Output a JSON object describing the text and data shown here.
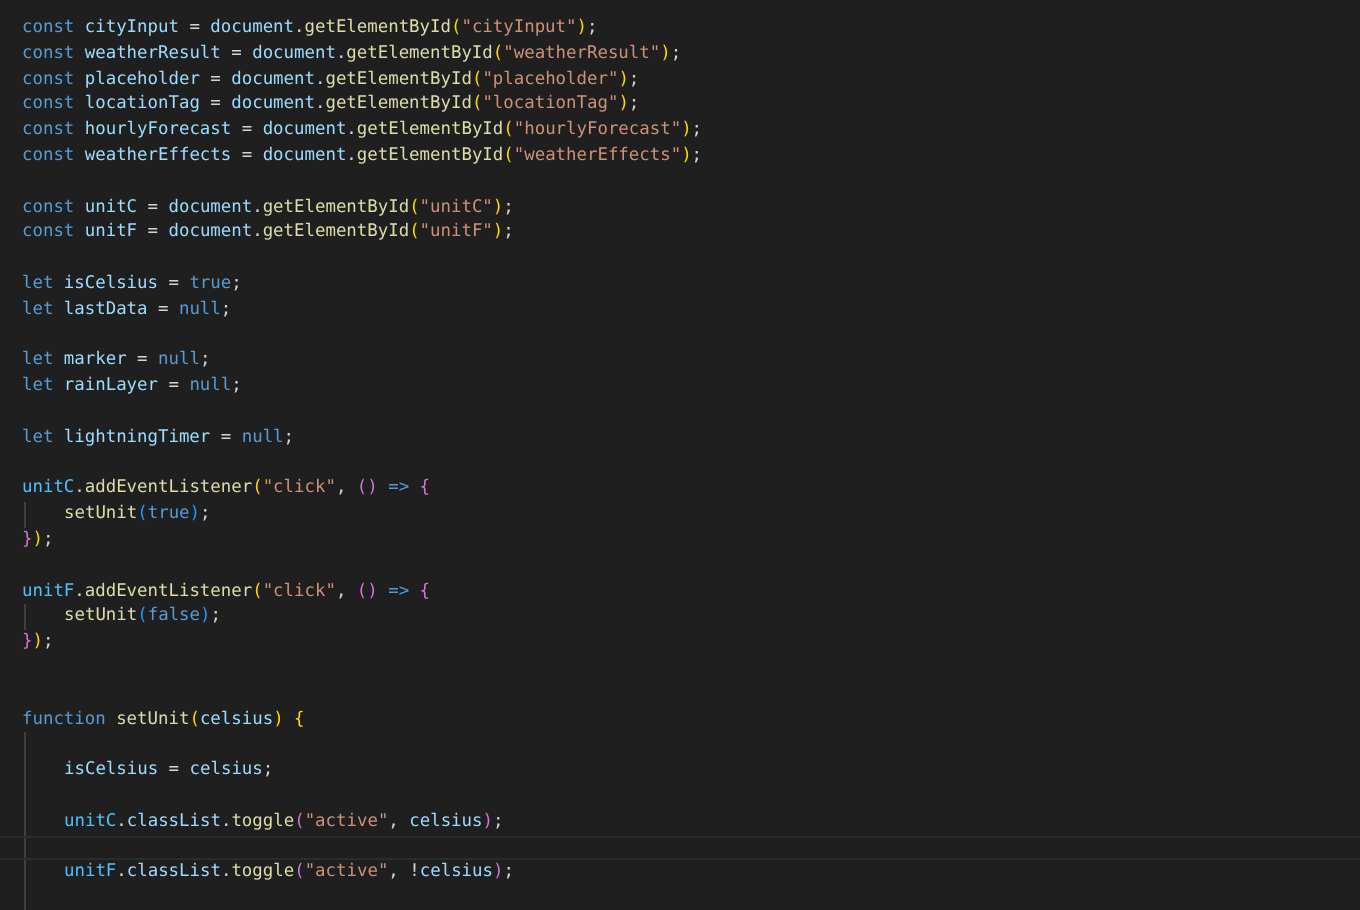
{
  "editor": {
    "lines": [
      {
        "kind": "code",
        "indented": false,
        "tokens": [
          {
            "kind": "keyword",
            "text": "const "
          },
          {
            "kind": "variable",
            "text": "cityInput"
          },
          {
            "kind": "plain",
            "text": " = "
          },
          {
            "kind": "variable",
            "text": "document"
          },
          {
            "kind": "plain",
            "text": "."
          },
          {
            "kind": "function",
            "text": "getElementById"
          },
          {
            "kind": "bracket1",
            "text": "("
          },
          {
            "kind": "string",
            "text": "\"cityInput\""
          },
          {
            "kind": "bracket1",
            "text": ")"
          },
          {
            "kind": "plain",
            "text": ";"
          }
        ]
      },
      {
        "kind": "code",
        "indented": false,
        "tokens": [
          {
            "kind": "keyword",
            "text": "const "
          },
          {
            "kind": "variable",
            "text": "weatherResult"
          },
          {
            "kind": "plain",
            "text": " = "
          },
          {
            "kind": "variable",
            "text": "document"
          },
          {
            "kind": "plain",
            "text": "."
          },
          {
            "kind": "function",
            "text": "getElementById"
          },
          {
            "kind": "bracket1",
            "text": "("
          },
          {
            "kind": "string",
            "text": "\"weatherResult\""
          },
          {
            "kind": "bracket1",
            "text": ")"
          },
          {
            "kind": "plain",
            "text": ";"
          }
        ]
      },
      {
        "kind": "code",
        "indented": false,
        "tokens": [
          {
            "kind": "keyword",
            "text": "const "
          },
          {
            "kind": "variable",
            "text": "placeholder"
          },
          {
            "kind": "plain",
            "text": " = "
          },
          {
            "kind": "variable",
            "text": "document"
          },
          {
            "kind": "plain",
            "text": "."
          },
          {
            "kind": "function",
            "text": "getElementById"
          },
          {
            "kind": "bracket1",
            "text": "("
          },
          {
            "kind": "string",
            "text": "\"placeholder\""
          },
          {
            "kind": "bracket1",
            "text": ")"
          },
          {
            "kind": "plain",
            "text": ";"
          }
        ]
      },
      {
        "kind": "code",
        "indented": false,
        "tokens": [
          {
            "kind": "keyword",
            "text": "const "
          },
          {
            "kind": "variable",
            "text": "locationTag"
          },
          {
            "kind": "plain",
            "text": " = "
          },
          {
            "kind": "variable",
            "text": "document"
          },
          {
            "kind": "plain",
            "text": "."
          },
          {
            "kind": "function",
            "text": "getElementById"
          },
          {
            "kind": "bracket1",
            "text": "("
          },
          {
            "kind": "string",
            "text": "\"locationTag\""
          },
          {
            "kind": "bracket1",
            "text": ")"
          },
          {
            "kind": "plain",
            "text": ";"
          }
        ]
      },
      {
        "kind": "code",
        "indented": false,
        "tokens": [
          {
            "kind": "keyword",
            "text": "const "
          },
          {
            "kind": "variable",
            "text": "hourlyForecast"
          },
          {
            "kind": "plain",
            "text": " = "
          },
          {
            "kind": "variable",
            "text": "document"
          },
          {
            "kind": "plain",
            "text": "."
          },
          {
            "kind": "function",
            "text": "getElementById"
          },
          {
            "kind": "bracket1",
            "text": "("
          },
          {
            "kind": "string",
            "text": "\"hourlyForecast\""
          },
          {
            "kind": "bracket1",
            "text": ")"
          },
          {
            "kind": "plain",
            "text": ";"
          }
        ]
      },
      {
        "kind": "code",
        "indented": false,
        "tokens": [
          {
            "kind": "keyword",
            "text": "const "
          },
          {
            "kind": "variable",
            "text": "weatherEffects"
          },
          {
            "kind": "plain",
            "text": " = "
          },
          {
            "kind": "variable",
            "text": "document"
          },
          {
            "kind": "plain",
            "text": "."
          },
          {
            "kind": "function",
            "text": "getElementById"
          },
          {
            "kind": "bracket1",
            "text": "("
          },
          {
            "kind": "string",
            "text": "\"weatherEffects\""
          },
          {
            "kind": "bracket1",
            "text": ")"
          },
          {
            "kind": "plain",
            "text": ";"
          }
        ]
      },
      {
        "kind": "blank",
        "indented": false
      },
      {
        "kind": "code",
        "indented": false,
        "tokens": [
          {
            "kind": "keyword",
            "text": "const "
          },
          {
            "kind": "variable",
            "text": "unitC"
          },
          {
            "kind": "plain",
            "text": " = "
          },
          {
            "kind": "variable",
            "text": "document"
          },
          {
            "kind": "plain",
            "text": "."
          },
          {
            "kind": "function",
            "text": "getElementById"
          },
          {
            "kind": "bracket1",
            "text": "("
          },
          {
            "kind": "string",
            "text": "\"unitC\""
          },
          {
            "kind": "bracket1",
            "text": ")"
          },
          {
            "kind": "plain",
            "text": ";"
          }
        ]
      },
      {
        "kind": "code",
        "indented": false,
        "tokens": [
          {
            "kind": "keyword",
            "text": "const "
          },
          {
            "kind": "variable",
            "text": "unitF"
          },
          {
            "kind": "plain",
            "text": " = "
          },
          {
            "kind": "variable",
            "text": "document"
          },
          {
            "kind": "plain",
            "text": "."
          },
          {
            "kind": "function",
            "text": "getElementById"
          },
          {
            "kind": "bracket1",
            "text": "("
          },
          {
            "kind": "string",
            "text": "\"unitF\""
          },
          {
            "kind": "bracket1",
            "text": ")"
          },
          {
            "kind": "plain",
            "text": ";"
          }
        ]
      },
      {
        "kind": "blank",
        "indented": false
      },
      {
        "kind": "code",
        "indented": false,
        "tokens": [
          {
            "kind": "keyword",
            "text": "let "
          },
          {
            "kind": "variable",
            "text": "isCelsius"
          },
          {
            "kind": "plain",
            "text": " = "
          },
          {
            "kind": "literal",
            "text": "true"
          },
          {
            "kind": "plain",
            "text": ";"
          }
        ]
      },
      {
        "kind": "code",
        "indented": false,
        "tokens": [
          {
            "kind": "keyword",
            "text": "let "
          },
          {
            "kind": "variable",
            "text": "lastData"
          },
          {
            "kind": "plain",
            "text": " = "
          },
          {
            "kind": "literal",
            "text": "null"
          },
          {
            "kind": "plain",
            "text": ";"
          }
        ]
      },
      {
        "kind": "blank",
        "indented": false
      },
      {
        "kind": "code",
        "indented": false,
        "tokens": [
          {
            "kind": "keyword",
            "text": "let "
          },
          {
            "kind": "variable",
            "text": "marker"
          },
          {
            "kind": "plain",
            "text": " = "
          },
          {
            "kind": "literal",
            "text": "null"
          },
          {
            "kind": "plain",
            "text": ";"
          }
        ]
      },
      {
        "kind": "code",
        "indented": false,
        "tokens": [
          {
            "kind": "keyword",
            "text": "let "
          },
          {
            "kind": "variable",
            "text": "rainLayer"
          },
          {
            "kind": "plain",
            "text": " = "
          },
          {
            "kind": "literal",
            "text": "null"
          },
          {
            "kind": "plain",
            "text": ";"
          }
        ]
      },
      {
        "kind": "blank",
        "indented": false
      },
      {
        "kind": "code",
        "indented": false,
        "tokens": [
          {
            "kind": "keyword",
            "text": "let "
          },
          {
            "kind": "variable",
            "text": "lightningTimer"
          },
          {
            "kind": "plain",
            "text": " = "
          },
          {
            "kind": "literal",
            "text": "null"
          },
          {
            "kind": "plain",
            "text": ";"
          }
        ]
      },
      {
        "kind": "blank",
        "indented": false
      },
      {
        "kind": "code",
        "indented": false,
        "tokens": [
          {
            "kind": "constant",
            "text": "unitC"
          },
          {
            "kind": "plain",
            "text": "."
          },
          {
            "kind": "function",
            "text": "addEventListener"
          },
          {
            "kind": "bracket1",
            "text": "("
          },
          {
            "kind": "string",
            "text": "\"click\""
          },
          {
            "kind": "plain",
            "text": ", "
          },
          {
            "kind": "bracket2",
            "text": "()"
          },
          {
            "kind": "keyword",
            "text": " => "
          },
          {
            "kind": "bracket2",
            "text": "{"
          }
        ]
      },
      {
        "kind": "code",
        "indented": true,
        "tokens": [
          {
            "kind": "function",
            "text": "setUnit"
          },
          {
            "kind": "bracket3",
            "text": "("
          },
          {
            "kind": "literal",
            "text": "true"
          },
          {
            "kind": "bracket3",
            "text": ")"
          },
          {
            "kind": "plain",
            "text": ";"
          }
        ]
      },
      {
        "kind": "code",
        "indented": false,
        "tokens": [
          {
            "kind": "bracket2",
            "text": "}"
          },
          {
            "kind": "bracket1",
            "text": ")"
          },
          {
            "kind": "plain",
            "text": ";"
          }
        ]
      },
      {
        "kind": "blank",
        "indented": false
      },
      {
        "kind": "code",
        "indented": false,
        "tokens": [
          {
            "kind": "constant",
            "text": "unitF"
          },
          {
            "kind": "plain",
            "text": "."
          },
          {
            "kind": "function",
            "text": "addEventListener"
          },
          {
            "kind": "bracket1",
            "text": "("
          },
          {
            "kind": "string",
            "text": "\"click\""
          },
          {
            "kind": "plain",
            "text": ", "
          },
          {
            "kind": "bracket2",
            "text": "()"
          },
          {
            "kind": "keyword",
            "text": " => "
          },
          {
            "kind": "bracket2",
            "text": "{"
          }
        ]
      },
      {
        "kind": "code",
        "indented": true,
        "tokens": [
          {
            "kind": "function",
            "text": "setUnit"
          },
          {
            "kind": "bracket3",
            "text": "("
          },
          {
            "kind": "literal",
            "text": "false"
          },
          {
            "kind": "bracket3",
            "text": ")"
          },
          {
            "kind": "plain",
            "text": ";"
          }
        ]
      },
      {
        "kind": "code",
        "indented": false,
        "tokens": [
          {
            "kind": "bracket2",
            "text": "}"
          },
          {
            "kind": "bracket1",
            "text": ")"
          },
          {
            "kind": "plain",
            "text": ";"
          }
        ]
      },
      {
        "kind": "blank",
        "indented": false
      },
      {
        "kind": "blank",
        "indented": false
      },
      {
        "kind": "code",
        "indented": false,
        "tokens": [
          {
            "kind": "keyword",
            "text": "function "
          },
          {
            "kind": "function",
            "text": "setUnit"
          },
          {
            "kind": "bracket1",
            "text": "("
          },
          {
            "kind": "variable",
            "text": "celsius"
          },
          {
            "kind": "bracket1",
            "text": ")"
          },
          {
            "kind": "bracket1",
            "text": " {"
          }
        ]
      },
      {
        "kind": "blank",
        "indented": true
      },
      {
        "kind": "code",
        "indented": true,
        "tokens": [
          {
            "kind": "variable",
            "text": "isCelsius"
          },
          {
            "kind": "plain",
            "text": " = "
          },
          {
            "kind": "variable",
            "text": "celsius"
          },
          {
            "kind": "plain",
            "text": ";"
          }
        ]
      },
      {
        "kind": "blank",
        "indented": true
      },
      {
        "kind": "code",
        "indented": true,
        "tokens": [
          {
            "kind": "constant",
            "text": "unitC"
          },
          {
            "kind": "plain",
            "text": "."
          },
          {
            "kind": "variable",
            "text": "classList"
          },
          {
            "kind": "plain",
            "text": "."
          },
          {
            "kind": "function",
            "text": "toggle"
          },
          {
            "kind": "bracket2",
            "text": "("
          },
          {
            "kind": "string",
            "text": "\"active\""
          },
          {
            "kind": "plain",
            "text": ", "
          },
          {
            "kind": "variable",
            "text": "celsius"
          },
          {
            "kind": "bracket2",
            "text": ")"
          },
          {
            "kind": "plain",
            "text": ";"
          }
        ]
      },
      {
        "kind": "blank",
        "indented": true,
        "current": true
      },
      {
        "kind": "code",
        "indented": true,
        "tokens": [
          {
            "kind": "constant",
            "text": "unitF"
          },
          {
            "kind": "plain",
            "text": "."
          },
          {
            "kind": "variable",
            "text": "classList"
          },
          {
            "kind": "plain",
            "text": "."
          },
          {
            "kind": "function",
            "text": "toggle"
          },
          {
            "kind": "bracket2",
            "text": "("
          },
          {
            "kind": "string",
            "text": "\"active\""
          },
          {
            "kind": "plain",
            "text": ", !"
          },
          {
            "kind": "variable",
            "text": "celsius"
          },
          {
            "kind": "bracket2",
            "text": ")"
          },
          {
            "kind": "plain",
            "text": ";"
          }
        ]
      },
      {
        "kind": "blank",
        "indented": true
      }
    ]
  }
}
